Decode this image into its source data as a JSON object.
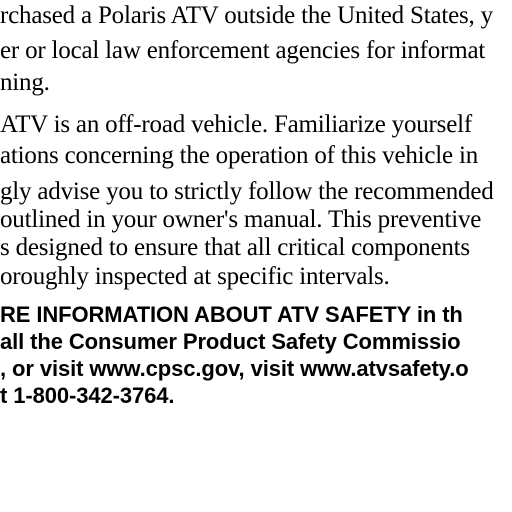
{
  "paragraph_1": {
    "lines": [
      "rchased a Polaris ATV outside the United States, y",
      "er or local law enforcement agencies for informat",
      "ning."
    ]
  },
  "paragraph_2": {
    "lines": [
      "ATV is an off-road vehicle. Familiarize yourself",
      "ations concerning the operation of this vehicle in"
    ]
  },
  "paragraph_3": {
    "lines": [
      "gly advise you to strictly follow the recommended",
      "outlined in your owner's manual. This preventive",
      "s designed to ensure that all critical components",
      "oroughly inspected at specific intervals."
    ]
  },
  "paragraph_4": {
    "lines": [
      "RE INFORMATION ABOUT ATV SAFETY in th",
      "all the Consumer Product Safety Commissio",
      ", or visit www.cpsc.gov, visit www.atvsafety.o",
      "t 1-800-342-3764."
    ]
  }
}
